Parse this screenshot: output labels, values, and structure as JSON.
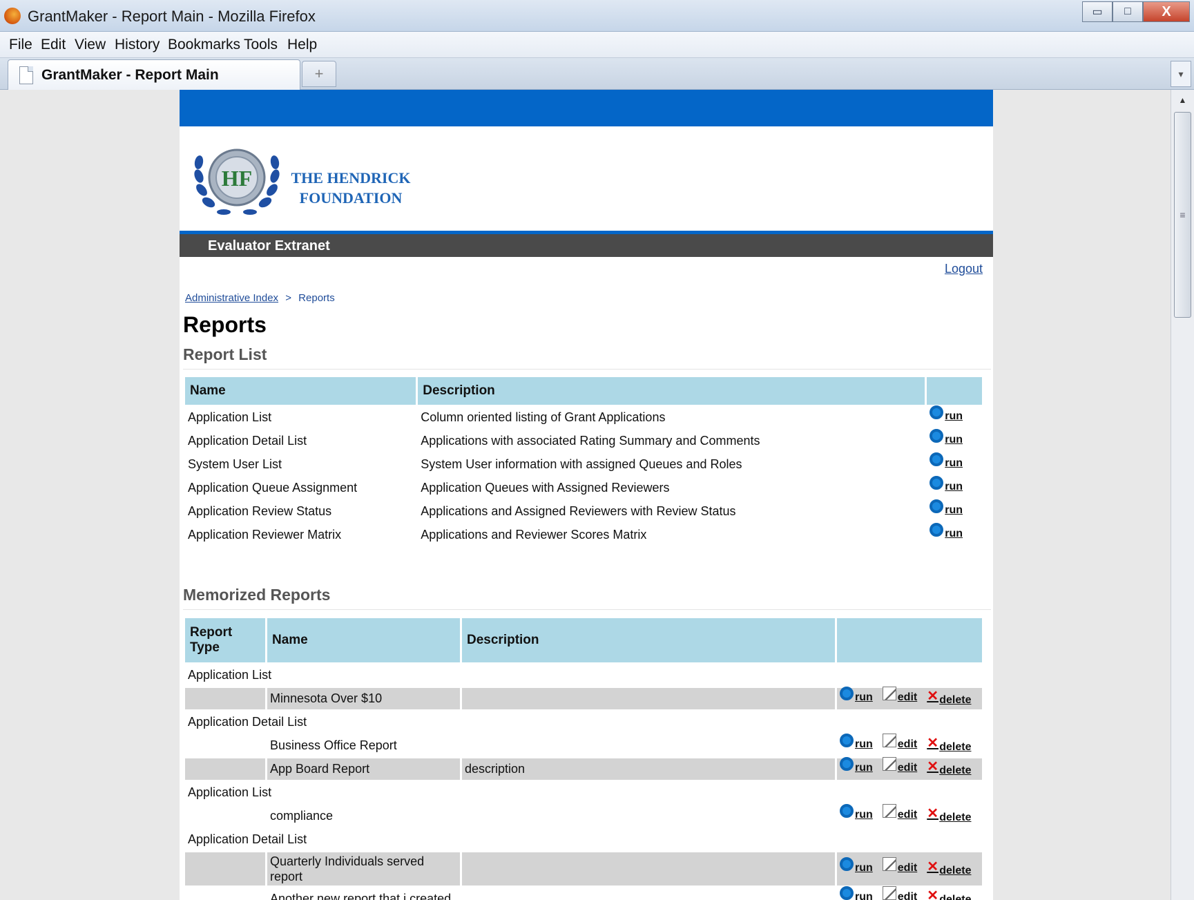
{
  "window": {
    "title": "GrantMaker - Report Main - Mozilla Firefox",
    "controls": {
      "minimize": "▭",
      "restore": "□",
      "close": "X"
    }
  },
  "menu": [
    "File",
    "Edit",
    "View",
    "History",
    "Bookmarks",
    "Tools",
    "Help"
  ],
  "tab": {
    "label": "GrantMaker - Report Main",
    "new_tab": "+",
    "list": "▾"
  },
  "site": {
    "foundation_line1": "THE HENDRICK",
    "foundation_line2": "FOUNDATION",
    "emblem_letters": "HF",
    "nav_title": "Evaluator Extranet",
    "logout": "Logout",
    "colors": {
      "brand_blue": "#0466c8",
      "nav_gray": "#4a4a4a",
      "header_cell": "#add8e6",
      "row_shade": "#d3d3d3"
    }
  },
  "breadcrumb": {
    "link": "Administrative Index",
    "separator": ">",
    "current": "Reports"
  },
  "page_title": "Reports",
  "report_list": {
    "title": "Report List",
    "headers": {
      "name": "Name",
      "description": "Description",
      "actions": ""
    },
    "run_label": "run",
    "rows": [
      {
        "name": "Application List",
        "description": "Column oriented listing of Grant Applications"
      },
      {
        "name": "Application Detail List",
        "description": "Applications with associated Rating Summary and Comments"
      },
      {
        "name": "System User List",
        "description": "System User information with assigned Queues and Roles"
      },
      {
        "name": "Application Queue Assignment",
        "description": "Application Queues with Assigned Reviewers"
      },
      {
        "name": "Application Review Status",
        "description": "Applications and Assigned Reviewers with Review Status"
      },
      {
        "name": "Application Reviewer Matrix",
        "description": "Applications and Reviewer Scores Matrix"
      }
    ]
  },
  "memorized_reports": {
    "title": "Memorized Reports",
    "headers": {
      "type_line1": "Report",
      "type_line2": "Type",
      "name": "Name",
      "description": "Description",
      "actions": ""
    },
    "actions": {
      "run": "run",
      "edit": "edit",
      "delete": "delete"
    },
    "groups": [
      {
        "type": "Application List",
        "items": [
          {
            "name": "Minnesota Over $10",
            "description": "",
            "shaded": true
          }
        ]
      },
      {
        "type": "Application Detail List",
        "items": [
          {
            "name": "Business Office Report",
            "description": "",
            "shaded": false
          },
          {
            "name": "App Board Report",
            "description": "description",
            "shaded": true
          }
        ]
      },
      {
        "type": "Application List",
        "items": [
          {
            "name": "compliance",
            "description": "",
            "shaded": false
          }
        ]
      },
      {
        "type": "Application Detail List",
        "items": [
          {
            "name": "Quarterly Individuals served report",
            "description": "",
            "shaded": true
          },
          {
            "name": "Another new report that i created",
            "description": "",
            "shaded": false
          }
        ]
      }
    ]
  },
  "icons": {
    "run": "run-icon",
    "edit": "edit-icon",
    "delete": "delete-icon",
    "firefox": "firefox-logo-icon",
    "page": "page-icon"
  }
}
